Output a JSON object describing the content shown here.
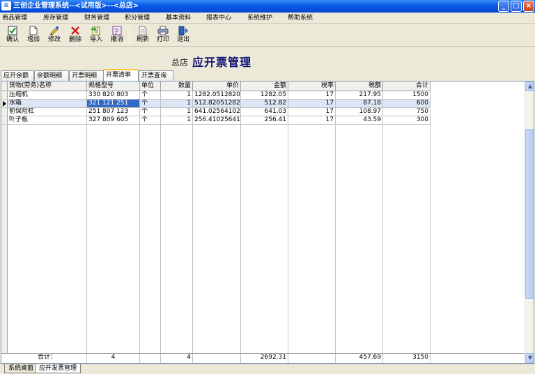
{
  "window": {
    "title": "三创企业管理系统--<试用版>--<总店>",
    "controls": [
      "_",
      "□",
      "×"
    ]
  },
  "menu": [
    "商品管理",
    "库存管理",
    "财务管理",
    "积分管理",
    "基本资料",
    "报表中心",
    "系统维护",
    "帮助系统"
  ],
  "toolbar": [
    {
      "label": "确认",
      "icon": "confirm-icon"
    },
    {
      "label": "增加",
      "icon": "add-icon"
    },
    {
      "label": "修改",
      "icon": "edit-icon"
    },
    {
      "label": "删除",
      "icon": "delete-icon"
    },
    {
      "label": "导入",
      "icon": "import-icon"
    },
    {
      "label": "撤消",
      "icon": "undo-icon"
    },
    {
      "label": "刷新",
      "icon": "refresh-icon"
    },
    {
      "label": "打印",
      "icon": "print-icon"
    },
    {
      "label": "退出",
      "icon": "exit-icon"
    }
  ],
  "header": {
    "branch": "总店",
    "title": "应开票管理"
  },
  "tabs": [
    "应开余额",
    "余额明细",
    "开票明细",
    "开票清单",
    "开票查询"
  ],
  "active_tab": "开票清单",
  "table": {
    "columns": [
      "货物(劳务)名称",
      "规格型号",
      "单位",
      "数量",
      "单价",
      "金额",
      "税率",
      "税额",
      "合计"
    ],
    "rows": [
      [
        "压缩机",
        "330 820 803",
        "个",
        "1",
        "1282.051282051",
        "1282.05",
        "17",
        "217.95",
        "1500"
      ],
      [
        "水箱",
        "321 121 251",
        "个",
        "1",
        "512.820512821",
        "512.82",
        "17",
        "87.18",
        "600"
      ],
      [
        "前保险杠",
        "251 807 123",
        "个",
        "1",
        "641.025641026",
        "641.03",
        "17",
        "108.97",
        "750"
      ],
      [
        "叶子板",
        "327 809 605",
        "个",
        "1",
        "256.41025641",
        "256.41",
        "17",
        "43.59",
        "300"
      ]
    ],
    "selected_row": 1,
    "totals": {
      "label": "合计：",
      "spec_count": "4",
      "quantity": "4",
      "amount": "2692.31",
      "tax": "457.69",
      "total": "3150"
    }
  },
  "bottom_tabs": [
    "系统桌面",
    "应开发票管理"
  ],
  "active_bottom_tab": "应开发票管理",
  "colors": {
    "title_bar": "#0A5DE8",
    "page_title": "#0D1070",
    "selection": "#316AC5"
  }
}
